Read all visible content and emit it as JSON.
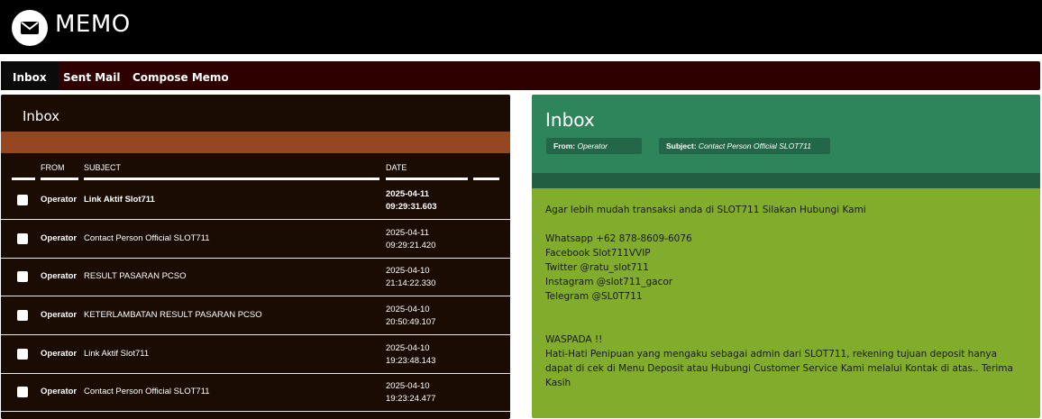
{
  "app": {
    "title": "MEMO",
    "logo_icon": "envelope-icon"
  },
  "nav": {
    "items": [
      {
        "label": "Inbox",
        "active": true
      },
      {
        "label": "Sent Mail",
        "active": false
      },
      {
        "label": "Compose Memo",
        "active": false
      }
    ]
  },
  "inbox": {
    "title": "Inbox",
    "columns": {
      "from": "FROM",
      "subject": "SUBJECT",
      "date": "DATE"
    },
    "rows": [
      {
        "from": "Operator",
        "subject": "Link Aktif Slot711",
        "date": "2025-04-11",
        "time": "09:29:31.603",
        "unread": true
      },
      {
        "from": "Operator",
        "subject": "Contact Person Official SLOT711",
        "date": "2025-04-11",
        "time": "09:29:21.420",
        "unread": false
      },
      {
        "from": "Operator",
        "subject": "RESULT PASARAN PCSO",
        "date": "2025-04-10",
        "time": "21:14:22.330",
        "unread": false
      },
      {
        "from": "Operator",
        "subject": "KETERLAMBATAN RESULT PASARAN PCSO",
        "date": "2025-04-10",
        "time": "20:50:49.107",
        "unread": false
      },
      {
        "from": "Operator",
        "subject": "Link Aktif Slot711",
        "date": "2025-04-10",
        "time": "19:23:48.143",
        "unread": false
      },
      {
        "from": "Operator",
        "subject": "Contact Person Official SLOT711",
        "date": "2025-04-10",
        "time": "19:23:24.477",
        "unread": false
      }
    ]
  },
  "message": {
    "title": "Inbox",
    "from_label": "From:",
    "from_value": "Operator",
    "subject_label": "Subject:",
    "subject_value": "Contact Person Official SLOT711",
    "body": {
      "intro": "Agar lebih mudah transaksi anda di SLOT711 Silakan Hubungi Kami",
      "contacts": [
        "Whatsapp +62 878-8609-6076",
        "Facebook  Slot711VVIP",
        "Twitter  @ratu_slot711",
        "Instagram  @slot711_gacor",
        "Telegram  @SL0T711"
      ],
      "warning_title": "WASPADA !!",
      "warning_lines": [
        "Hati-Hati Penipuan yang mengaku sebagai admin dari SLOT711, rekening tujuan deposit hanya",
        "dapat di cek di Menu Deposit atau Hubungi Customer Service Kami melalui Kontak di atas.. Terima",
        "Kasih"
      ]
    }
  },
  "colors": {
    "header_bg": "#000000",
    "nav_bg": "#2e0000",
    "inbox_bg": "#1a0c03",
    "inbox_bar": "#964621",
    "msg_head": "#2e855c",
    "msg_body": "#82ac2b"
  }
}
